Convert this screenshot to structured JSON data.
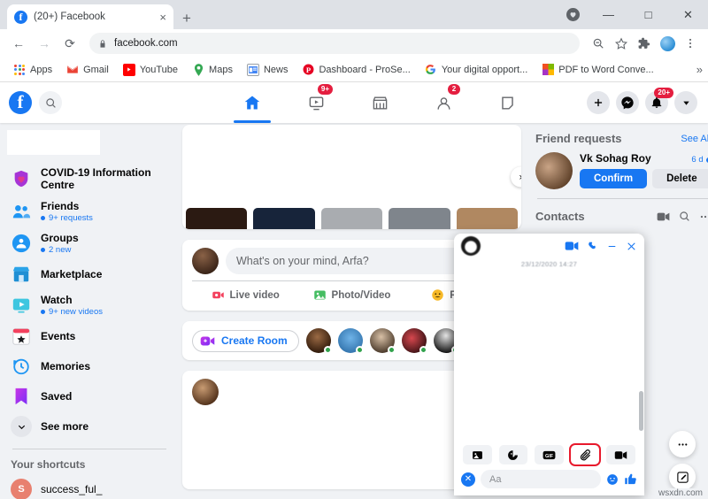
{
  "browser": {
    "tab": {
      "title": "(20+) Facebook",
      "favicon": "facebook-icon",
      "close": "×"
    },
    "new_tab_label": "+",
    "window_controls": {
      "minimize": "—",
      "maximize": "□",
      "close": "✕"
    },
    "nav": {
      "back": "←",
      "forward": "→",
      "reload": "⟳"
    },
    "omnibox": {
      "url": "facebook.com",
      "lock": "lock-icon"
    },
    "toolbar_icons": [
      "zoom-out-icon",
      "bookmark-star-icon",
      "extensions-icon",
      "profile-avatar",
      "chrome-menu-icon"
    ],
    "bookmarks": [
      {
        "label": "Apps",
        "icon": "apps-grid-icon",
        "color": "#4285f4"
      },
      {
        "label": "Gmail",
        "icon": "gmail-icon",
        "color": "#ea4335"
      },
      {
        "label": "YouTube",
        "icon": "youtube-icon",
        "color": "#ff0000"
      },
      {
        "label": "Maps",
        "icon": "maps-icon",
        "color": "#34a853"
      },
      {
        "label": "News",
        "icon": "news-icon",
        "color": "#4285f4"
      },
      {
        "label": "Dashboard - ProSe...",
        "icon": "pinterest-icon",
        "color": "#e60023"
      },
      {
        "label": "Your digital opport...",
        "icon": "google-icon",
        "color": "#4285f4"
      },
      {
        "label": "PDF to Word Conve...",
        "icon": "pdf-converter-icon",
        "color": "#f25022"
      }
    ],
    "bookmarks_overflow": "»"
  },
  "fbnav": {
    "logo": "f",
    "search": "search-icon",
    "tabs": [
      {
        "name": "home",
        "icon": "home-icon",
        "active": true,
        "badge": ""
      },
      {
        "name": "watch",
        "icon": "watch-icon",
        "active": false,
        "badge": "9+"
      },
      {
        "name": "marketplace",
        "icon": "marketplace-icon",
        "active": false,
        "badge": ""
      },
      {
        "name": "groups",
        "icon": "groups-icon",
        "active": false,
        "badge": "2"
      },
      {
        "name": "gaming",
        "icon": "gaming-icon",
        "active": false,
        "badge": ""
      }
    ],
    "actions": [
      {
        "name": "create",
        "icon": "plus-icon",
        "badge": ""
      },
      {
        "name": "messenger",
        "icon": "messenger-icon",
        "badge": ""
      },
      {
        "name": "notifications",
        "icon": "bell-icon",
        "badge": "20+"
      },
      {
        "name": "account",
        "icon": "chevron-down-icon",
        "badge": ""
      }
    ]
  },
  "sidebar": {
    "items": [
      {
        "label": "COVID-19 Information Centre",
        "sub": "",
        "icon": "covid-shield-icon"
      },
      {
        "label": "Friends",
        "sub": "9+ requests",
        "icon": "friends-icon"
      },
      {
        "label": "Groups",
        "sub": "2 new",
        "icon": "groups-icon"
      },
      {
        "label": "Marketplace",
        "sub": "",
        "icon": "marketplace-icon"
      },
      {
        "label": "Watch",
        "sub": "9+ new videos",
        "icon": "watch-icon"
      },
      {
        "label": "Events",
        "sub": "",
        "icon": "events-icon"
      },
      {
        "label": "Memories",
        "sub": "",
        "icon": "memories-icon"
      },
      {
        "label": "Saved",
        "sub": "",
        "icon": "saved-bookmark-icon"
      },
      {
        "label": "See more",
        "sub": "",
        "icon": "chevron-down-icon"
      }
    ],
    "shortcuts_title": "Your shortcuts",
    "shortcuts": [
      {
        "label": "success_ful_",
        "initial": "S"
      }
    ]
  },
  "feed": {
    "stories_next": "›",
    "composer": {
      "placeholder": "What's on your mind, Arfa?",
      "actions": [
        {
          "label": "Live video",
          "icon": "live-video-icon",
          "color": "#f3425f"
        },
        {
          "label": "Photo/Video",
          "icon": "photo-video-icon",
          "color": "#45bd62"
        },
        {
          "label": "Feeling",
          "icon": "feeling-icon",
          "color": "#f7b928"
        }
      ]
    },
    "room": {
      "label": "Create Room",
      "icon": "video-room-icon"
    }
  },
  "right_sidebar": {
    "friend_requests_title": "Friend requests",
    "see_all": "See All",
    "request": {
      "name": "Vk Sohag Roy",
      "time": "6 d",
      "confirm": "Confirm",
      "delete": "Delete"
    },
    "contacts_title": "Contacts",
    "contacts_icons": [
      "new-video-room-icon",
      "search-icon",
      "options-icon"
    ]
  },
  "chat": {
    "header_icons": [
      "video-call-icon",
      "voice-call-icon",
      "minimize-icon",
      "close-icon"
    ],
    "timestamp": "23/12/2020 14:27",
    "tools": [
      {
        "name": "photo",
        "icon": "photo-icon",
        "highlighted": false
      },
      {
        "name": "sticker",
        "icon": "sticker-icon",
        "highlighted": false
      },
      {
        "name": "gif",
        "icon": "gif-icon",
        "highlighted": false
      },
      {
        "name": "attach-file",
        "icon": "paperclip-icon",
        "highlighted": true
      },
      {
        "name": "video",
        "icon": "video-icon",
        "highlighted": false
      }
    ],
    "input_placeholder": "Aa",
    "close_composer": "✕",
    "emoji": "emoji-icon",
    "like": "thumbs-up-icon",
    "highlight_color": "#e8192c"
  },
  "fabs": [
    {
      "name": "more-options",
      "icon": "ellipsis-icon",
      "label": "•••"
    },
    {
      "name": "new-message",
      "icon": "compose-icon",
      "label": ""
    }
  ],
  "watermark": "wsxdn.com"
}
